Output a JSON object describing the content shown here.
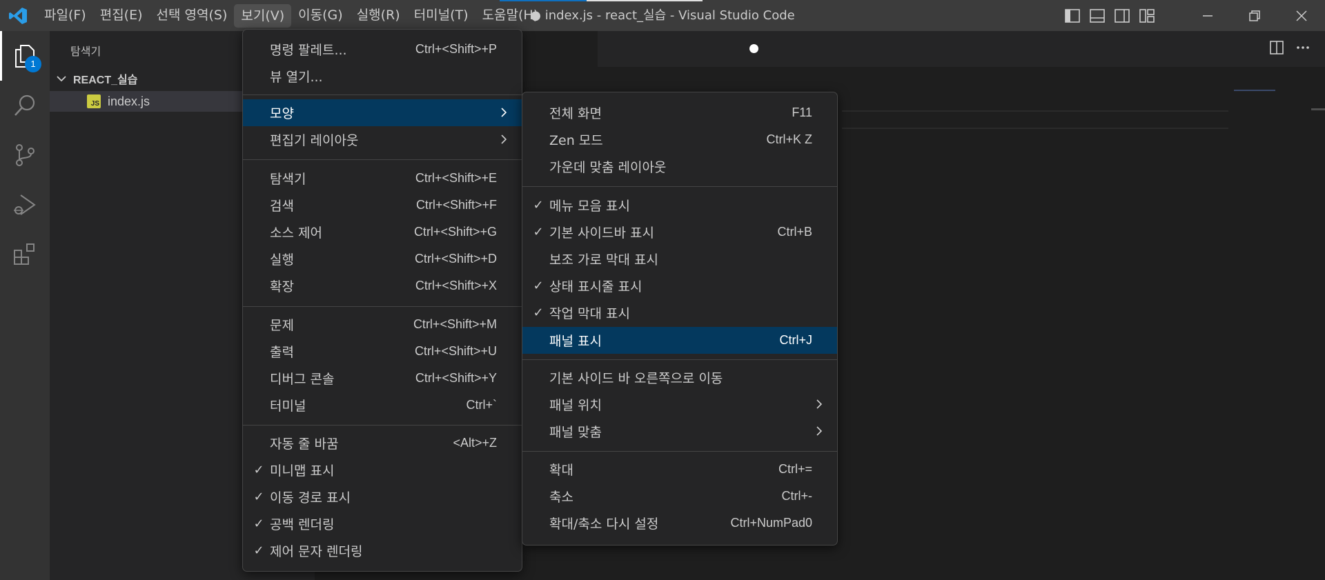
{
  "menubar": {
    "items": [
      "파일(F)",
      "편집(E)",
      "선택 영역(S)",
      "보기(V)",
      "이동(G)",
      "실행(R)",
      "터미널(T)",
      "도움말(H)"
    ],
    "active_index": 3
  },
  "window": {
    "title": "● index.js - react_실습 - Visual Studio Code"
  },
  "activity": {
    "explorer_badge": "1"
  },
  "sidebar": {
    "title": "탐색기",
    "folder": "REACT_실습",
    "file_icon_text": "JS",
    "file": "index.js"
  },
  "view_menu": {
    "items": [
      {
        "label": "명령 팔레트...",
        "shortcut": "Ctrl+<Shift>+P",
        "checked": false
      },
      {
        "label": "뷰 열기...",
        "shortcut": "",
        "checked": false
      },
      {
        "label": "모양",
        "shortcut": "",
        "checked": false,
        "submenu": true,
        "highlighted": true
      },
      {
        "label": "편집기 레이아웃",
        "shortcut": "",
        "checked": false,
        "submenu": true
      },
      {
        "label": "탐색기",
        "shortcut": "Ctrl+<Shift>+E",
        "checked": false
      },
      {
        "label": "검색",
        "shortcut": "Ctrl+<Shift>+F",
        "checked": false
      },
      {
        "label": "소스 제어",
        "shortcut": "Ctrl+<Shift>+G",
        "checked": false
      },
      {
        "label": "실행",
        "shortcut": "Ctrl+<Shift>+D",
        "checked": false
      },
      {
        "label": "확장",
        "shortcut": "Ctrl+<Shift>+X",
        "checked": false
      },
      {
        "label": "문제",
        "shortcut": "Ctrl+<Shift>+M",
        "checked": false
      },
      {
        "label": "출력",
        "shortcut": "Ctrl+<Shift>+U",
        "checked": false
      },
      {
        "label": "디버그 콘솔",
        "shortcut": "Ctrl+<Shift>+Y",
        "checked": false
      },
      {
        "label": "터미널",
        "shortcut": "Ctrl+`",
        "checked": false
      },
      {
        "label": "자동 줄 바꿈",
        "shortcut": "<Alt>+Z",
        "checked": false
      },
      {
        "label": "미니맵 표시",
        "shortcut": "",
        "checked": true
      },
      {
        "label": "이동 경로 표시",
        "shortcut": "",
        "checked": true
      },
      {
        "label": "공백 렌더링",
        "shortcut": "",
        "checked": true
      },
      {
        "label": "제어 문자 렌더링",
        "shortcut": "",
        "checked": true
      }
    ]
  },
  "appearance_menu": {
    "items": [
      {
        "label": "전체 화면",
        "shortcut": "F11",
        "checked": false
      },
      {
        "label": "Zen 모드",
        "shortcut": "Ctrl+K Z",
        "checked": false
      },
      {
        "label": "가운데 맞춤 레이아웃",
        "shortcut": "",
        "checked": false
      },
      {
        "label": "메뉴 모음 표시",
        "shortcut": "",
        "checked": true
      },
      {
        "label": "기본 사이드바 표시",
        "shortcut": "Ctrl+B",
        "checked": true
      },
      {
        "label": "보조 가로 막대 표시",
        "shortcut": "",
        "checked": false
      },
      {
        "label": "상태 표시줄 표시",
        "shortcut": "",
        "checked": true
      },
      {
        "label": "작업 막대 표시",
        "shortcut": "",
        "checked": true
      },
      {
        "label": "패널 표시",
        "shortcut": "Ctrl+J",
        "checked": false,
        "highlighted": true
      },
      {
        "label": "기본 사이드 바 오른쪽으로 이동",
        "shortcut": "",
        "checked": false
      },
      {
        "label": "패널 위치",
        "shortcut": "",
        "checked": false,
        "submenu": true
      },
      {
        "label": "패널 맞춤",
        "shortcut": "",
        "checked": false,
        "submenu": true
      },
      {
        "label": "확대",
        "shortcut": "Ctrl+=",
        "checked": false
      },
      {
        "label": "축소",
        "shortcut": "Ctrl+-",
        "checked": false
      },
      {
        "label": "확대/축소 다시 설정",
        "shortcut": "Ctrl+NumPad0",
        "checked": false
      }
    ]
  },
  "colors": {
    "highlight": "#04395e",
    "accent": "#0078d4",
    "js_icon": "#cbcb41"
  }
}
